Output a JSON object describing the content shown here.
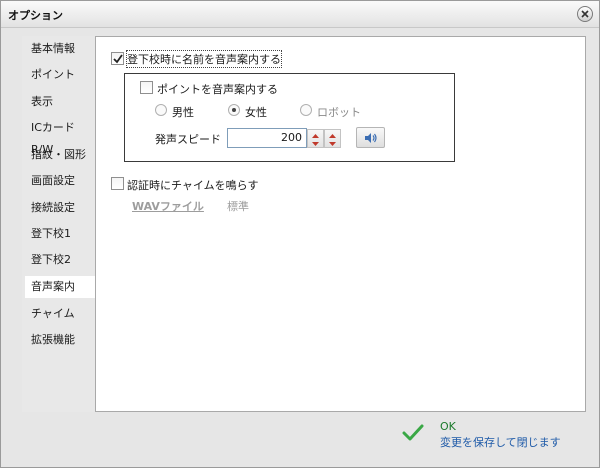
{
  "window": {
    "title": "オプション",
    "close_icon": "close-icon"
  },
  "sidebar": {
    "items": [
      {
        "label": "基本情報"
      },
      {
        "label": "ポイント"
      },
      {
        "label": "表示"
      },
      {
        "label": "ICカードR/W"
      },
      {
        "label": "指紋・図形"
      },
      {
        "label": "画面設定"
      },
      {
        "label": "接続設定"
      },
      {
        "label": "登下校1"
      },
      {
        "label": "登下校2"
      },
      {
        "label": "音声案内",
        "active": true
      },
      {
        "label": "チャイム"
      },
      {
        "label": "拡張機能"
      }
    ]
  },
  "voice": {
    "announce_name": {
      "label": "登下校時に名前を音声案内する",
      "checked": true
    },
    "announce_points": {
      "label": "ポイントを音声案内する",
      "checked": false
    },
    "gender": {
      "options": [
        {
          "label": "男性",
          "selected": false
        },
        {
          "label": "女性",
          "selected": true
        },
        {
          "label": "ロボット",
          "selected": false
        }
      ]
    },
    "speed": {
      "label": "発声スピード",
      "value": "200"
    },
    "preview_icon": "speaker-icon"
  },
  "chime": {
    "label": "認証時にチャイムを鳴らす",
    "checked": false,
    "wav_label": "WAVファイル",
    "standard_label": "標準"
  },
  "footer": {
    "ok_label": "OK",
    "ok_desc": "変更を保存して閉じます",
    "accent_green": "#3aa846",
    "accent_blue": "#1e5aa8"
  }
}
